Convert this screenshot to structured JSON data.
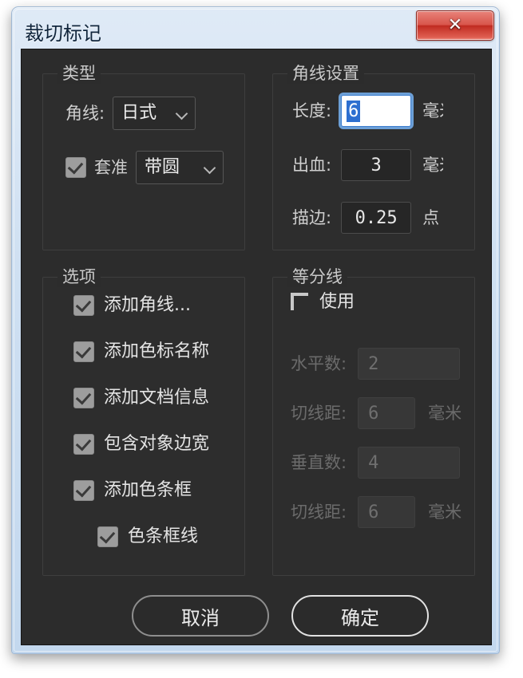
{
  "window": {
    "title": "裁切标记",
    "close_label": "✕",
    "frame_color": "#cfe0f2",
    "body_color": "#2c2c2c"
  },
  "groups": {
    "type": {
      "title": "类型",
      "corner_line": {
        "label": "角线:",
        "value": "日式"
      },
      "registration": {
        "checkbox_label": "套准",
        "checked": true,
        "value": "带圆"
      }
    },
    "corner_settings": {
      "title": "角线设置",
      "rows": [
        {
          "label": "长度:",
          "value": "6",
          "unit": "毫米",
          "focused": true
        },
        {
          "label": "出血:",
          "value": "3",
          "unit": "毫米",
          "focused": false
        },
        {
          "label": "描边:",
          "value": "0.25",
          "unit": "点",
          "focused": false
        }
      ]
    },
    "options": {
      "title": "选项",
      "items": [
        {
          "label": "添加角线...",
          "checked": true,
          "indent": false
        },
        {
          "label": "添加色标名称",
          "checked": true,
          "indent": false
        },
        {
          "label": "添加文档信息",
          "checked": true,
          "indent": false
        },
        {
          "label": "包含对象边宽",
          "checked": true,
          "indent": false
        },
        {
          "label": "添加色条框",
          "checked": true,
          "indent": false
        },
        {
          "label": "色条框线",
          "checked": true,
          "indent": true
        }
      ]
    },
    "divider_lines": {
      "title": "等分线",
      "enable": {
        "label": "使用",
        "checked": false
      },
      "disabled": true,
      "rows": [
        {
          "label": "水平数:",
          "value": "2",
          "unit": ""
        },
        {
          "label": "切线距:",
          "value": "6",
          "unit": "毫米"
        },
        {
          "label": "垂直数:",
          "value": "4",
          "unit": ""
        },
        {
          "label": "切线距:",
          "value": "6",
          "unit": "毫米"
        }
      ]
    }
  },
  "footer": {
    "cancel": "取消",
    "ok": "确定"
  }
}
